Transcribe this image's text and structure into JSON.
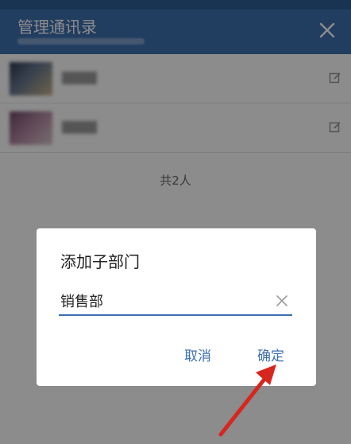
{
  "header": {
    "title": "管理通讯录"
  },
  "list": {
    "count_text": "共2人"
  },
  "dialog": {
    "title": "添加子部门",
    "input_value": "销售部",
    "cancel_label": "取消",
    "ok_label": "确定"
  },
  "colors": {
    "accent": "#3c6fb0",
    "arrow": "#d7261e"
  },
  "icons": [
    "close-icon",
    "edit-icon",
    "clear-icon"
  ]
}
